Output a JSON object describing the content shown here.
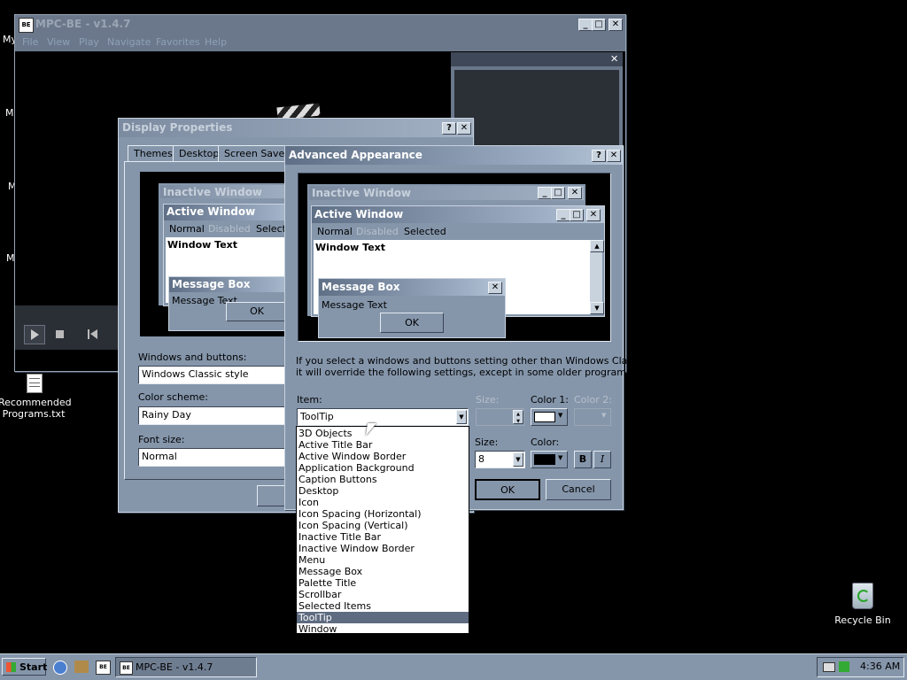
{
  "desktop": {
    "icons": [
      {
        "name": "Recommended Programs.txt"
      },
      {
        "name": "Recycle Bin"
      }
    ],
    "edge_fragments": [
      "My",
      "M",
      "M",
      "M"
    ]
  },
  "mpc": {
    "title": "MPC-BE - v1.4.7",
    "menu": [
      "File",
      "View",
      "Play",
      "Navigate",
      "Favorites",
      "Help"
    ],
    "panel_close": "✕"
  },
  "display_properties": {
    "title": "Display Properties",
    "tabs": [
      "Themes",
      "Desktop",
      "Screen Saver"
    ],
    "preview": {
      "inactive_title": "Inactive Window",
      "active_title": "Active Window",
      "menu_normal": "Normal",
      "menu_disabled": "Disabled",
      "menu_selected": "Selecte",
      "window_text": "Window Text",
      "msgbox_title": "Message Box",
      "msgbox_text": "Message Text",
      "ok": "OK"
    },
    "windows_buttons_label": "Windows and buttons:",
    "windows_buttons_value": "Windows Classic style",
    "color_scheme_label": "Color scheme:",
    "color_scheme_value": "Rainy Day",
    "font_size_label": "Font size:",
    "font_size_value": "Normal"
  },
  "advanced": {
    "title": "Advanced Appearance",
    "preview": {
      "inactive_title": "Inactive Window",
      "active_title": "Active Window",
      "menu_normal": "Normal",
      "menu_disabled": "Disabled",
      "menu_selected": "Selected",
      "window_text": "Window Text",
      "msgbox_title": "Message Box",
      "msgbox_text": "Message Text",
      "ok": "OK"
    },
    "info_line1": "If you select a windows and buttons setting other than Windows Classic,",
    "info_line2": "it will override the following settings, except in some older programs.",
    "item_label": "Item:",
    "item_value": "ToolTip",
    "size_label": "Size:",
    "color1_label": "Color 1:",
    "color2_label": "Color 2:",
    "font_size_label": "Size:",
    "font_size_value": "8",
    "color_label": "Color:",
    "bold": "B",
    "italic": "I",
    "ok": "OK",
    "cancel": "Cancel",
    "item_list": [
      "3D Objects",
      "Active Title Bar",
      "Active Window Border",
      "Application Background",
      "Caption Buttons",
      "Desktop",
      "Icon",
      "Icon Spacing (Horizontal)",
      "Icon Spacing (Vertical)",
      "Inactive Title Bar",
      "Inactive Window Border",
      "Menu",
      "Message Box",
      "Palette Title",
      "Scrollbar",
      "Selected Items",
      "ToolTip",
      "Window"
    ],
    "selected_item": "ToolTip"
  },
  "taskbar": {
    "start": "Start",
    "task": "MPC-BE - v1.4.7",
    "clock": "4:36 AM"
  },
  "colors": {
    "window_face": "#8596ab",
    "active_title_start": "#5e6f86",
    "desktop": "#000000",
    "selection": "#5e6b80"
  }
}
